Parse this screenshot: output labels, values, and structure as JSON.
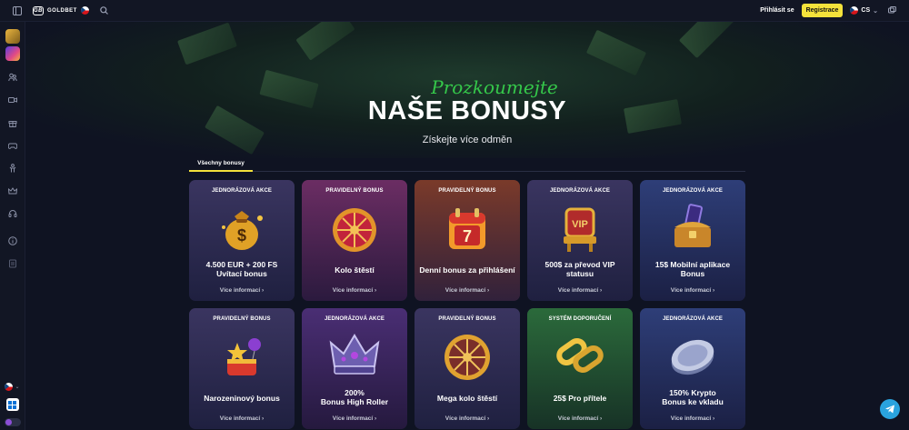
{
  "header": {
    "brand": "GOLDBET",
    "logo_mark": "GB",
    "login_label": "Přihlásit se",
    "register_label": "Registrace",
    "language": "CS",
    "register_color": "#f4e23b"
  },
  "sidebar": {
    "icons": [
      "user-group-icon",
      "video-icon",
      "gift-icon",
      "gamepad-icon",
      "trophy-person-icon",
      "crown-icon",
      "headset-icon",
      "info-icon",
      "document-icon"
    ],
    "language_icon": "cz-flag-icon"
  },
  "hero": {
    "kicker": "Prozkoumejte",
    "title": "NAŠE BONUSY",
    "subtitle": "Získejte více odměn"
  },
  "tabs": {
    "active": "Všechny bonusy"
  },
  "cards": [
    {
      "badge": "JEDNORÁZOVÁ AKCE",
      "title": "4.500 EUR + 200 FS\nUvítací bonus",
      "more": "Více informací",
      "icon": "money-bag-icon"
    },
    {
      "badge": "PRAVIDELNÝ BONUS",
      "title": "Kolo štěstí",
      "more": "Více informací",
      "icon": "fortune-wheel-icon"
    },
    {
      "badge": "PRAVIDELNÝ BONUS",
      "title": "Denní bonus za přihlášení",
      "more": "Více informací",
      "icon": "calendar-icon"
    },
    {
      "badge": "JEDNORÁZOVÁ AKCE",
      "title": "500$ za převod VIP\nstatusu",
      "more": "Více informací",
      "icon": "vip-throne-icon"
    },
    {
      "badge": "JEDNORÁZOVÁ AKCE",
      "title": "15$ Mobilní aplikace\nBonus",
      "more": "Více informací",
      "icon": "treasure-chest-phone-icon"
    },
    {
      "badge": "PRAVIDELNÝ BONUS",
      "title": "Narozeninový bonus",
      "more": "Více informací",
      "icon": "birthday-cake-icon"
    },
    {
      "badge": "JEDNORÁZOVÁ AKCE",
      "title": "200%\nBonus High Roller",
      "more": "Více informací",
      "icon": "crown-icon"
    },
    {
      "badge": "PRAVIDELNÝ BONUS",
      "title": "Mega kolo štěstí",
      "more": "Více informací",
      "icon": "mega-wheel-icon"
    },
    {
      "badge": "SYSTÉM DOPORUČENÍ",
      "title": "25$ Pro přítele",
      "more": "Více informací",
      "icon": "chain-link-icon"
    },
    {
      "badge": "JEDNORÁZOVÁ AKCE",
      "title": "150% Krypto\nBonus ke vkladu",
      "more": "Více informací",
      "icon": "crypto-coin-icon"
    }
  ]
}
